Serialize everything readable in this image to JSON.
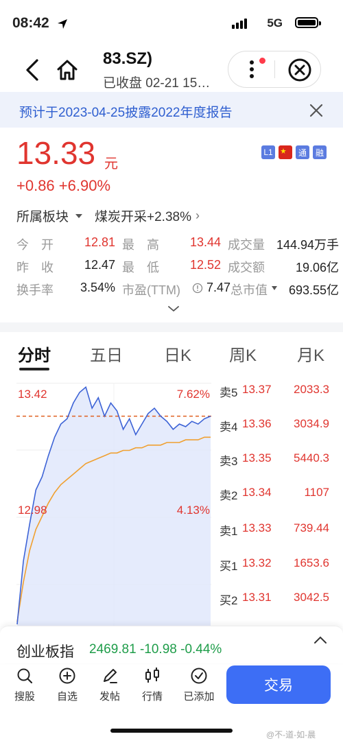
{
  "status": {
    "time": "08:42",
    "network": "5G"
  },
  "header": {
    "title": "83.SZ)",
    "subtitle": "已收盘 02-21 15…"
  },
  "notice": {
    "text": "预计于2023-04-25披露2022年度报告"
  },
  "quote": {
    "price": "13.33",
    "unit": "元",
    "change": "+0.86 +6.90%",
    "badges": [
      {
        "text": "L1",
        "color": "#5b7be0"
      },
      {
        "text": "",
        "color": "#d9261c"
      },
      {
        "text": "通",
        "color": "#5b7be0"
      },
      {
        "text": "融",
        "color": "#5b7be0"
      }
    ],
    "sector_label": "所属板块",
    "sector_value": "煤炭开采+2.38%"
  },
  "stats": {
    "open_label": "今　开",
    "open": "12.81",
    "high_label": "最　高",
    "high": "13.44",
    "volume_label": "成交量",
    "volume": "144.94万手",
    "prev_label": "昨　收",
    "prev": "12.47",
    "low_label": "最　低",
    "low": "12.52",
    "amount_label": "成交额",
    "amount": "19.06亿",
    "turnover_label": "换手率",
    "turnover": "3.54%",
    "pe_label": "市盈(TTM)",
    "pe": "7.47",
    "mktcap_label": "总市值",
    "mktcap": "693.55亿"
  },
  "tabs": [
    "分时",
    "五日",
    "日K",
    "周K",
    "月K"
  ],
  "chart_data": {
    "type": "line",
    "y_price_labels": [
      "13.42",
      "12.98"
    ],
    "y_pct_labels": [
      "7.62%",
      "4.13%"
    ],
    "prev_close_ref": "13.33",
    "series": [
      {
        "values": [
          12.52,
          12.78,
          12.92,
          13.05,
          13.1,
          13.18,
          13.25,
          13.3,
          13.32,
          13.38,
          13.42,
          13.44,
          13.36,
          13.4,
          13.33,
          13.38,
          13.35,
          13.28,
          13.32,
          13.26,
          13.3,
          13.34,
          13.36,
          13.33,
          13.31,
          13.28,
          13.3,
          13.29,
          13.31,
          13.3,
          13.32,
          13.33
        ]
      },
      {
        "values": [
          12.55,
          12.7,
          12.82,
          12.9,
          12.95,
          13.0,
          13.04,
          13.07,
          13.09,
          13.11,
          13.13,
          13.15,
          13.16,
          13.17,
          13.18,
          13.19,
          13.19,
          13.2,
          13.2,
          13.21,
          13.21,
          13.22,
          13.22,
          13.22,
          13.23,
          13.23,
          13.23,
          13.24,
          13.24,
          13.24,
          13.25,
          13.25
        ]
      }
    ],
    "colors": {
      "price": "#3d63d6",
      "avg": "#f0a030",
      "ref": "#e06020"
    }
  },
  "orderbook": [
    {
      "name": "卖5",
      "price": "13.37",
      "vol": "2033.3"
    },
    {
      "name": "卖4",
      "price": "13.36",
      "vol": "3034.9"
    },
    {
      "name": "卖3",
      "price": "13.35",
      "vol": "5440.3"
    },
    {
      "name": "卖2",
      "price": "13.34",
      "vol": "1107"
    },
    {
      "name": "卖1",
      "price": "13.33",
      "vol": "739.44"
    },
    {
      "name": "买1",
      "price": "13.32",
      "vol": "1653.6"
    },
    {
      "name": "买2",
      "price": "13.31",
      "vol": "3042.5"
    }
  ],
  "index": {
    "name": "创业板指",
    "values": "2469.81 -10.98 -0.44%"
  },
  "nav": [
    {
      "label": "搜股",
      "icon": "search-icon"
    },
    {
      "label": "自选",
      "icon": "add-icon"
    },
    {
      "label": "发帖",
      "icon": "pen-icon"
    },
    {
      "label": "行情",
      "icon": "candlestick-icon"
    },
    {
      "label": "已添加",
      "icon": "check-icon"
    }
  ],
  "trade_label": "交易",
  "watermark": "@不-道-如-晨"
}
